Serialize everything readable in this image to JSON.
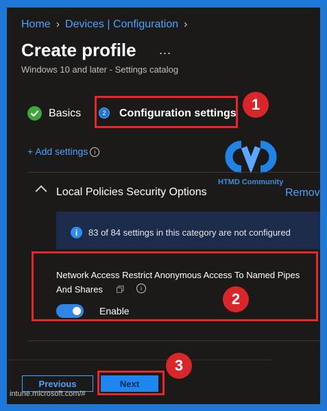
{
  "breadcrumb": {
    "home": "Home",
    "section": "Devices | Configuration"
  },
  "header": {
    "title": "Create profile",
    "more": "...",
    "subtitle": "Windows 10 and later - Settings catalog"
  },
  "steps": {
    "basics": "Basics",
    "config_number": "2",
    "config": "Configuration settings"
  },
  "add_settings": "+ Add settings",
  "watermark": "HTMD Community",
  "section": {
    "title": "Local Policies Security Options",
    "remove": "Remove"
  },
  "info_bar": {
    "text": "83 of 84 settings in this category are not configured"
  },
  "setting": {
    "line1": "Network Access Restrict Anonymous Access To Named Pipes",
    "line2": "And Shares",
    "toggle_label": "Enable",
    "enabled": true
  },
  "buttons": {
    "previous": "Previous",
    "next": "Next"
  },
  "status_url": "intune.microsoft.com/#",
  "callouts": [
    "1",
    "2",
    "3"
  ],
  "colors": {
    "accent": "#4aa3ff",
    "highlight": "#e8262b",
    "badge": "#d9262b",
    "success": "#3da83a"
  }
}
